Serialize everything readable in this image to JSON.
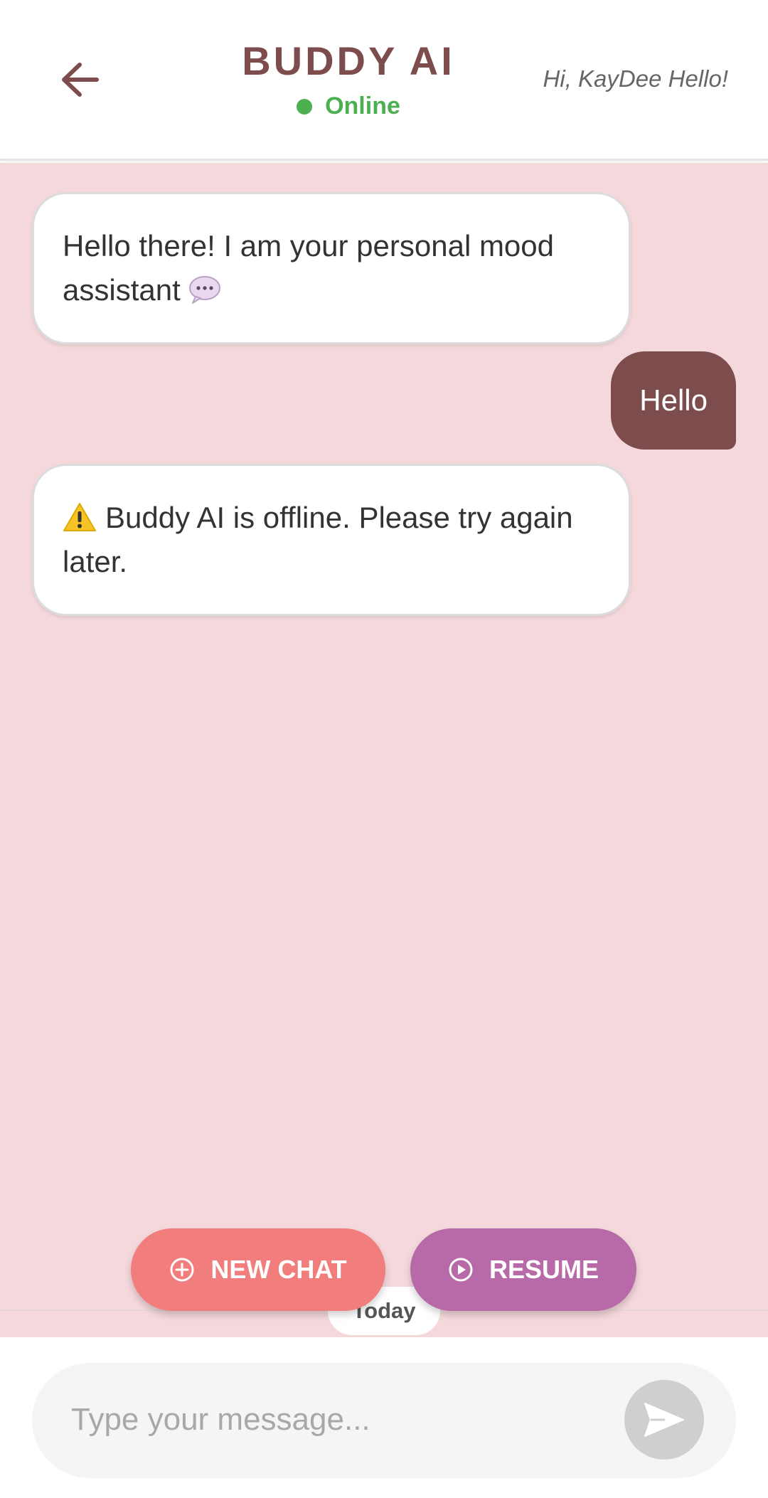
{
  "header": {
    "title": "BUDDY AI",
    "status": "Online",
    "greeting": "Hi, KayDee Hello!"
  },
  "messages": [
    {
      "sender": "bot",
      "text": "Hello there! I am your personal mood assistant",
      "icon": "speech-bubble-icon"
    },
    {
      "sender": "user",
      "text": "Hello"
    },
    {
      "sender": "bot",
      "text": "Buddy AI is offline. Please try again later.",
      "icon": "warning-icon"
    }
  ],
  "divider": {
    "label": "Today"
  },
  "actions": {
    "new_chat": "NEW CHAT",
    "resume": "RESUME"
  },
  "composer": {
    "placeholder": "Type your message...",
    "value": ""
  },
  "colors": {
    "brand": "#7d4c4c",
    "online": "#4caf50",
    "chat_background": "#f4d8dc",
    "new_chat_button": "#f27d7d",
    "resume_button": "#b86aa8",
    "send_button": "#cfcfcf"
  }
}
